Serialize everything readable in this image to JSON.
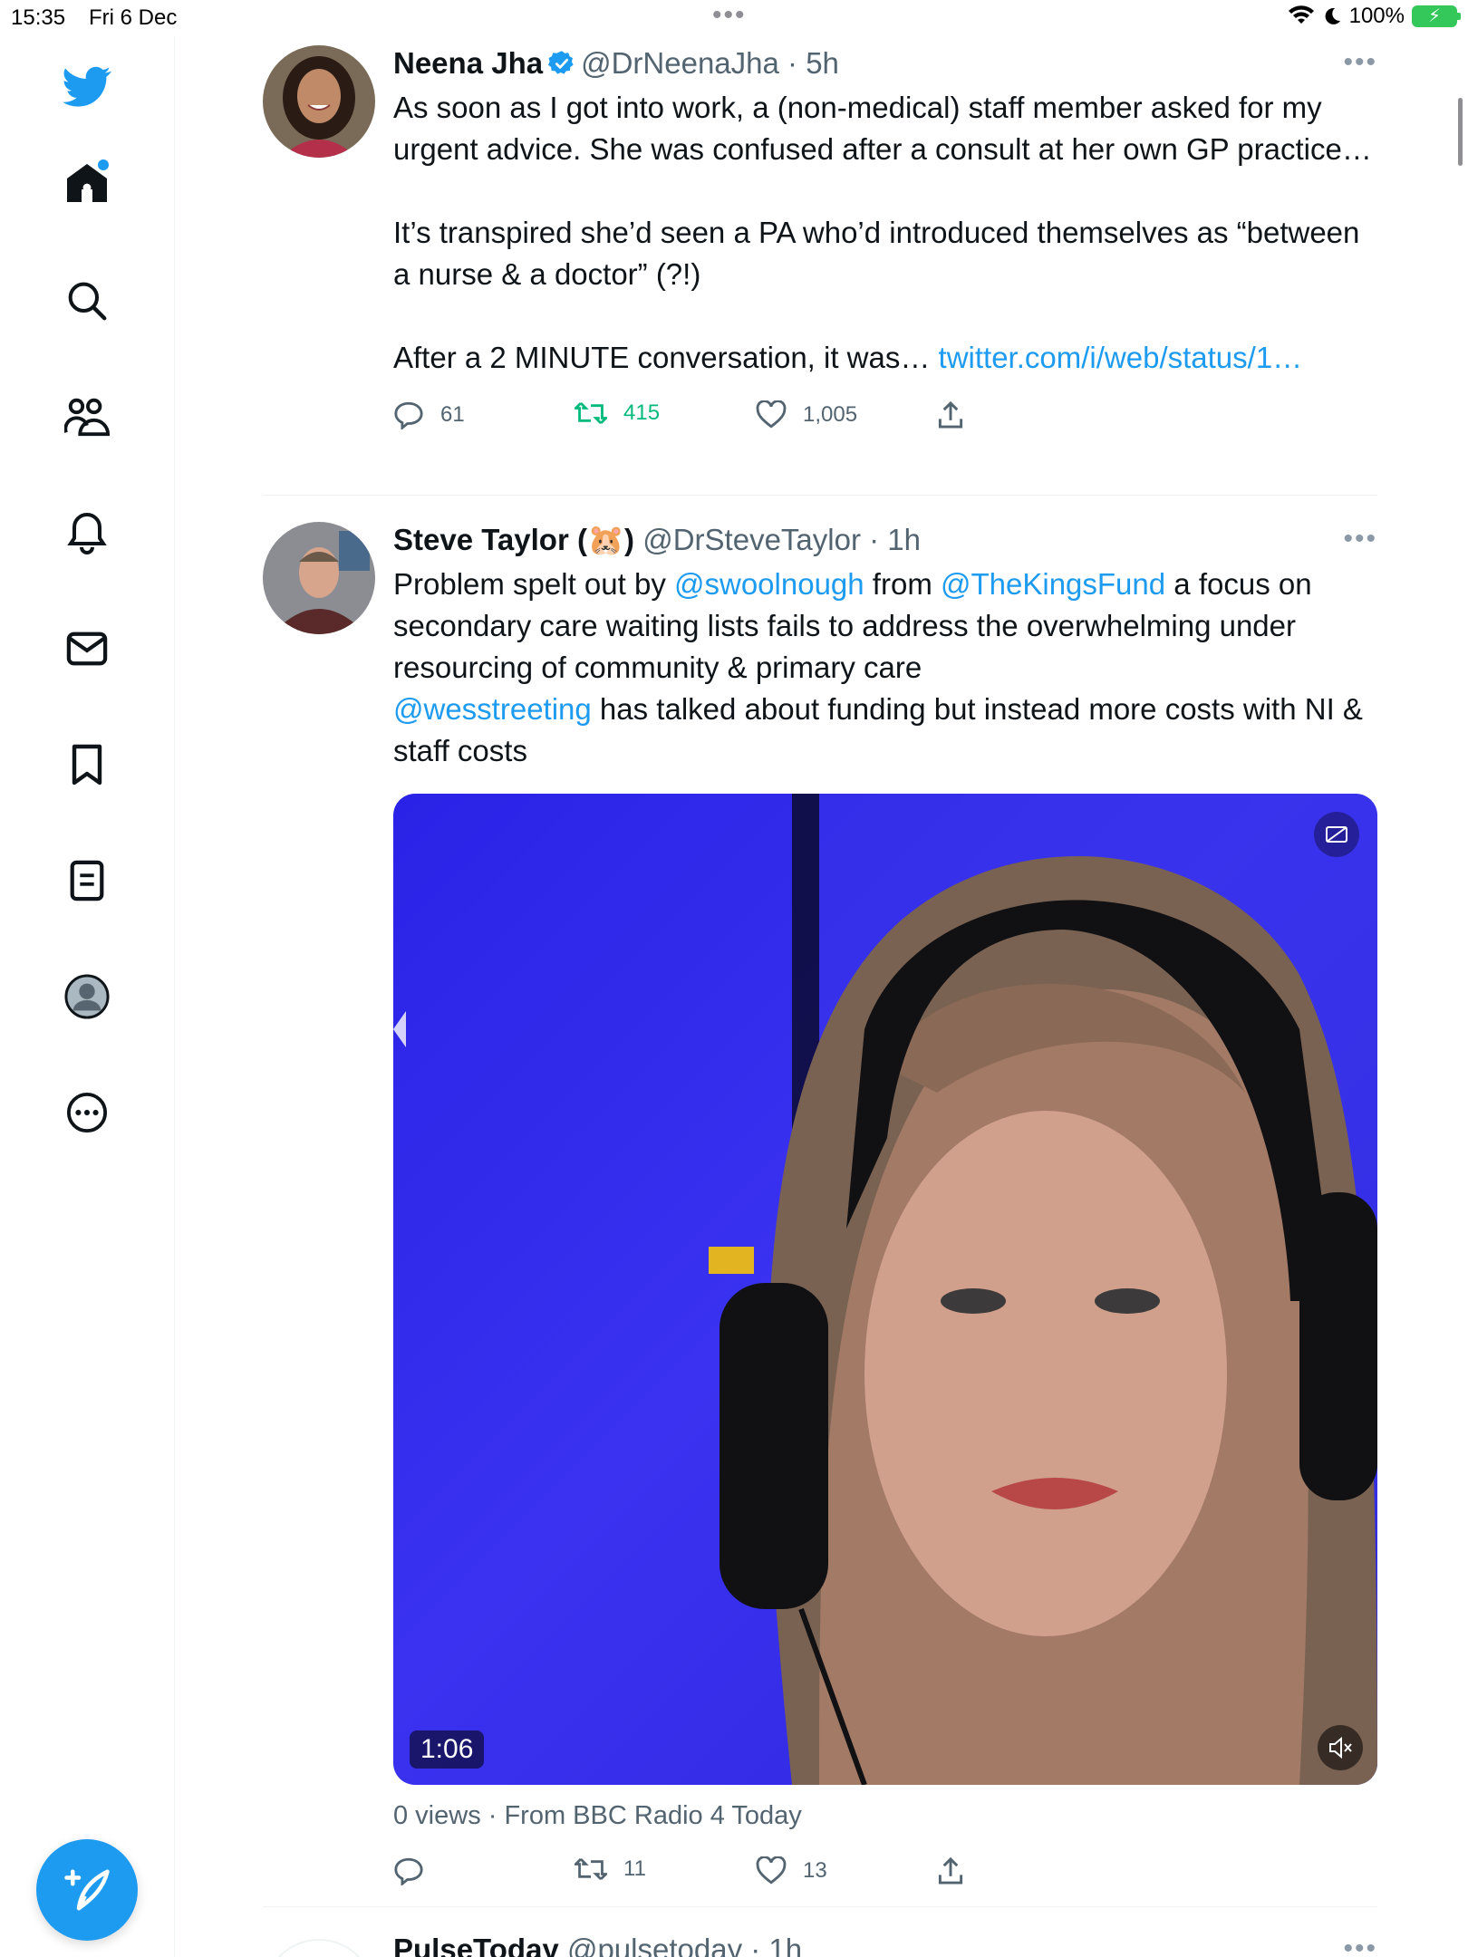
{
  "status_bar": {
    "time": "15:35",
    "date": "Fri 6 Dec",
    "battery": "100%"
  },
  "nav": {
    "icons": [
      "twitter-bird-icon",
      "home-icon",
      "search-icon",
      "communities-icon",
      "notifications-icon",
      "messages-icon",
      "bookmarks-icon",
      "lists-icon",
      "profile-icon",
      "more-icon"
    ],
    "compose_icon": "compose-icon",
    "accent": "#1d9bf0"
  },
  "tweets": [
    {
      "name": "Neena Jha",
      "verified": true,
      "handle": "@DrNeenaJha",
      "time": "· 5h",
      "text_lines": [
        "As soon as I got into work, a (non-medical) staff member asked for my urgent advice. She was confused after a consult at her own GP practice…",
        "",
        "It’s transpired she’d seen a PA who’d introduced themselves as “between a nurse & a doctor” (?!)",
        "",
        "After a 2 MINUTE conversation, it was…"
      ],
      "link": "twitter.com/i/web/status/1…",
      "replies": "61",
      "retweets": "415",
      "likes": "1,005"
    },
    {
      "name": "Steve Taylor (🐹)",
      "handle": "@DrSteveTaylor",
      "time": "· 1h",
      "text_a": "Problem spelt out by ",
      "mention_1": "@swoolnough",
      "text_b": " from ",
      "mention_2": "@TheKingsFund",
      "text_c": " a focus on secondary care waiting lists fails to address the overwhelming under resourcing of community & primary care",
      "mention_3": "@wesstreeting",
      "text_d": " has talked about funding but instead more costs with NI & staff costs",
      "video_duration": "1:06",
      "views": "0 views · From BBC Radio 4 Today",
      "replies": "",
      "retweets": "11",
      "likes": "13"
    },
    {
      "name": "PulseToday",
      "handle": "@pulsetoday",
      "time": "· 1h"
    }
  ]
}
